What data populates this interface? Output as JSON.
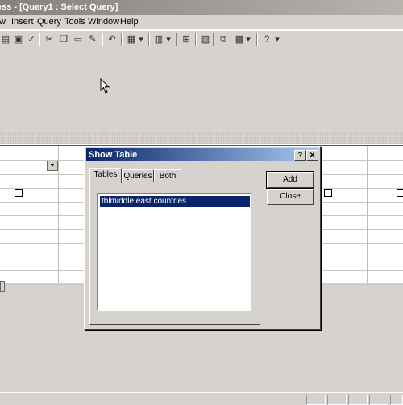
{
  "window": {
    "title": "ess - [Query1 : Select Query]"
  },
  "menu": [
    {
      "label": "w",
      "u": ""
    },
    {
      "label": "Insert"
    },
    {
      "label": "Query"
    },
    {
      "label": "Tools"
    },
    {
      "label": "Window"
    },
    {
      "label": "Help"
    }
  ],
  "dialog": {
    "title": "Show Table",
    "help_glyph": "?",
    "close_glyph": "✕",
    "tabs": [
      {
        "label": "Tables",
        "active": true
      },
      {
        "label": "Queries",
        "active": false
      },
      {
        "label": "Both",
        "active": false
      }
    ],
    "items": [
      "tblmiddle east countries"
    ],
    "selected_index": 0,
    "buttons": {
      "add": "Add",
      "close": "Close"
    }
  },
  "colors": {
    "dialog_title": "#0a246a",
    "selection": "#0a246a",
    "face": "#d6d3ce"
  }
}
